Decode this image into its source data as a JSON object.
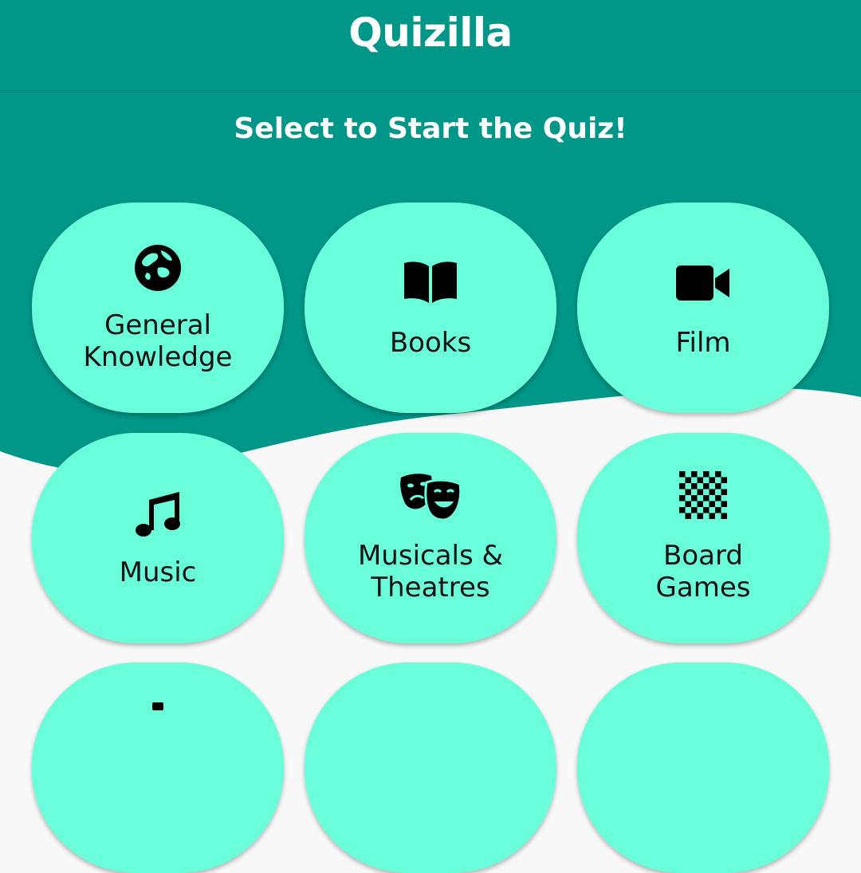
{
  "app": {
    "title": "Quizilla"
  },
  "page": {
    "subtitle": "Select to Start the Quiz!"
  },
  "colors": {
    "primary": "#009688",
    "tile": "#69fdd9",
    "background": "#f8f8f8",
    "icon": "#000000"
  },
  "categories": [
    {
      "label": "General\nKnowledge",
      "icon": "globe-icon"
    },
    {
      "label": "Books",
      "icon": "book-icon"
    },
    {
      "label": "Film",
      "icon": "video-camera-icon"
    },
    {
      "label": "Music",
      "icon": "music-note-icon"
    },
    {
      "label": "Musicals &\nTheatres",
      "icon": "theater-masks-icon"
    },
    {
      "label": "Board\nGames",
      "icon": "chessboard-icon"
    }
  ]
}
